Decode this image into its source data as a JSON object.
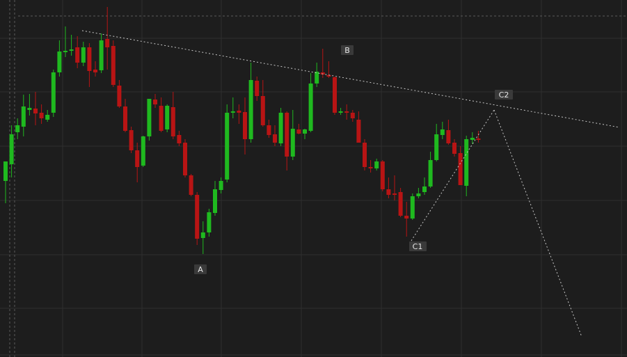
{
  "chart_data": {
    "type": "candlestick",
    "x_range": [
      0,
      115
    ],
    "y_range": [
      0,
      513
    ],
    "grid": true,
    "colors": {
      "up": "#1fb91f",
      "down": "#b81414",
      "background": "#1d1d1d",
      "grid": "#2f2f2f",
      "trend": "#c8c8c8"
    },
    "candles": [
      {
        "x": 0,
        "o": 260,
        "h": 235,
        "l": 292,
        "c": 232
      },
      {
        "x": 1,
        "o": 236,
        "h": 180,
        "l": 255,
        "c": 193
      },
      {
        "x": 2,
        "o": 190,
        "h": 170,
        "l": 200,
        "c": 180
      },
      {
        "x": 3,
        "o": 182,
        "h": 136,
        "l": 196,
        "c": 153
      },
      {
        "x": 4,
        "o": 158,
        "h": 135,
        "l": 166,
        "c": 155
      },
      {
        "x": 5,
        "o": 156,
        "h": 132,
        "l": 180,
        "c": 163
      },
      {
        "x": 6,
        "o": 162,
        "h": 150,
        "l": 178,
        "c": 170
      },
      {
        "x": 7,
        "o": 172,
        "h": 158,
        "l": 175,
        "c": 165
      },
      {
        "x": 8,
        "o": 162,
        "h": 100,
        "l": 168,
        "c": 104
      },
      {
        "x": 9,
        "o": 104,
        "h": 58,
        "l": 110,
        "c": 74
      },
      {
        "x": 10,
        "o": 74,
        "h": 38,
        "l": 82,
        "c": 73
      },
      {
        "x": 11,
        "o": 72,
        "h": 50,
        "l": 80,
        "c": 71
      },
      {
        "x": 12,
        "o": 68,
        "h": 52,
        "l": 98,
        "c": 90
      },
      {
        "x": 13,
        "o": 90,
        "h": 60,
        "l": 95,
        "c": 68
      },
      {
        "x": 14,
        "o": 68,
        "h": 62,
        "l": 125,
        "c": 102
      },
      {
        "x": 15,
        "o": 100,
        "h": 88,
        "l": 110,
        "c": 104
      },
      {
        "x": 16,
        "o": 101,
        "h": 48,
        "l": 105,
        "c": 58
      },
      {
        "x": 17,
        "o": 56,
        "h": 10,
        "l": 100,
        "c": 68
      },
      {
        "x": 18,
        "o": 66,
        "h": 58,
        "l": 125,
        "c": 122
      },
      {
        "x": 19,
        "o": 123,
        "h": 115,
        "l": 155,
        "c": 153
      },
      {
        "x": 20,
        "o": 153,
        "h": 142,
        "l": 190,
        "c": 188
      },
      {
        "x": 21,
        "o": 187,
        "h": 182,
        "l": 220,
        "c": 216
      },
      {
        "x": 22,
        "o": 216,
        "h": 205,
        "l": 262,
        "c": 240
      },
      {
        "x": 23,
        "o": 238,
        "h": 195,
        "l": 240,
        "c": 196
      },
      {
        "x": 24,
        "o": 196,
        "h": 142,
        "l": 202,
        "c": 142
      },
      {
        "x": 25,
        "o": 143,
        "h": 135,
        "l": 155,
        "c": 150
      },
      {
        "x": 26,
        "o": 152,
        "h": 140,
        "l": 190,
        "c": 188
      },
      {
        "x": 27,
        "o": 186,
        "h": 150,
        "l": 190,
        "c": 152
      },
      {
        "x": 28,
        "o": 154,
        "h": 132,
        "l": 200,
        "c": 196
      },
      {
        "x": 29,
        "o": 194,
        "h": 188,
        "l": 210,
        "c": 206
      },
      {
        "x": 30,
        "o": 205,
        "h": 200,
        "l": 255,
        "c": 252
      },
      {
        "x": 31,
        "o": 252,
        "h": 250,
        "l": 282,
        "c": 280
      },
      {
        "x": 32,
        "o": 280,
        "h": 276,
        "l": 352,
        "c": 343
      },
      {
        "x": 33,
        "o": 342,
        "h": 318,
        "l": 365,
        "c": 334
      },
      {
        "x": 34,
        "o": 334,
        "h": 300,
        "l": 340,
        "c": 305
      },
      {
        "x": 35,
        "o": 306,
        "h": 260,
        "l": 310,
        "c": 272
      },
      {
        "x": 36,
        "o": 273,
        "h": 255,
        "l": 278,
        "c": 260
      },
      {
        "x": 37,
        "o": 258,
        "h": 150,
        "l": 262,
        "c": 162
      },
      {
        "x": 38,
        "o": 162,
        "h": 140,
        "l": 170,
        "c": 160
      },
      {
        "x": 39,
        "o": 159,
        "h": 150,
        "l": 178,
        "c": 162
      },
      {
        "x": 40,
        "o": 161,
        "h": 140,
        "l": 222,
        "c": 200
      },
      {
        "x": 41,
        "o": 200,
        "h": 90,
        "l": 205,
        "c": 115
      },
      {
        "x": 42,
        "o": 116,
        "h": 110,
        "l": 145,
        "c": 138
      },
      {
        "x": 43,
        "o": 138,
        "h": 115,
        "l": 182,
        "c": 180
      },
      {
        "x": 44,
        "o": 180,
        "h": 172,
        "l": 198,
        "c": 194
      },
      {
        "x": 45,
        "o": 193,
        "h": 180,
        "l": 210,
        "c": 205
      },
      {
        "x": 46,
        "o": 206,
        "h": 155,
        "l": 210,
        "c": 162
      },
      {
        "x": 47,
        "o": 162,
        "h": 160,
        "l": 245,
        "c": 225
      },
      {
        "x": 48,
        "o": 225,
        "h": 158,
        "l": 230,
        "c": 185
      },
      {
        "x": 49,
        "o": 186,
        "h": 178,
        "l": 193,
        "c": 192
      },
      {
        "x": 50,
        "o": 192,
        "h": 185,
        "l": 200,
        "c": 186
      },
      {
        "x": 51,
        "o": 188,
        "h": 105,
        "l": 190,
        "c": 120
      },
      {
        "x": 52,
        "o": 120,
        "h": 90,
        "l": 125,
        "c": 103
      },
      {
        "x": 53,
        "o": 104,
        "h": 70,
        "l": 112,
        "c": 107
      },
      {
        "x": 54,
        "o": 108,
        "h": 88,
        "l": 112,
        "c": 110
      },
      {
        "x": 55,
        "o": 111,
        "h": 110,
        "l": 165,
        "c": 162
      },
      {
        "x": 56,
        "o": 161,
        "h": 155,
        "l": 165,
        "c": 160
      },
      {
        "x": 57,
        "o": 160,
        "h": 150,
        "l": 172,
        "c": 162
      },
      {
        "x": 58,
        "o": 162,
        "h": 158,
        "l": 175,
        "c": 170
      },
      {
        "x": 59,
        "o": 172,
        "h": 160,
        "l": 205,
        "c": 205
      },
      {
        "x": 60,
        "o": 205,
        "h": 200,
        "l": 245,
        "c": 240
      },
      {
        "x": 61,
        "o": 240,
        "h": 230,
        "l": 248,
        "c": 242
      },
      {
        "x": 62,
        "o": 242,
        "h": 228,
        "l": 245,
        "c": 232
      },
      {
        "x": 63,
        "o": 232,
        "h": 230,
        "l": 275,
        "c": 272
      },
      {
        "x": 64,
        "o": 272,
        "h": 255,
        "l": 285,
        "c": 280
      },
      {
        "x": 65,
        "o": 278,
        "h": 252,
        "l": 288,
        "c": 278
      },
      {
        "x": 66,
        "o": 276,
        "h": 270,
        "l": 312,
        "c": 310
      },
      {
        "x": 67,
        "o": 310,
        "h": 290,
        "l": 340,
        "c": 314
      },
      {
        "x": 68,
        "o": 314,
        "h": 278,
        "l": 316,
        "c": 282
      },
      {
        "x": 69,
        "o": 282,
        "h": 270,
        "l": 285,
        "c": 278
      },
      {
        "x": 70,
        "o": 276,
        "h": 255,
        "l": 280,
        "c": 268
      },
      {
        "x": 71,
        "o": 268,
        "h": 218,
        "l": 270,
        "c": 230
      },
      {
        "x": 72,
        "o": 230,
        "h": 178,
        "l": 232,
        "c": 193
      },
      {
        "x": 73,
        "o": 194,
        "h": 175,
        "l": 200,
        "c": 186
      },
      {
        "x": 74,
        "o": 187,
        "h": 172,
        "l": 208,
        "c": 206
      },
      {
        "x": 75,
        "o": 205,
        "h": 200,
        "l": 225,
        "c": 221
      },
      {
        "x": 76,
        "o": 220,
        "h": 210,
        "l": 265,
        "c": 266
      },
      {
        "x": 77,
        "o": 267,
        "h": 195,
        "l": 282,
        "c": 200
      },
      {
        "x": 78,
        "o": 201,
        "h": 190,
        "l": 207,
        "c": 198
      },
      {
        "x": 79,
        "o": 199,
        "h": 188,
        "l": 205,
        "c": 199
      }
    ],
    "labels": [
      {
        "text": "A"
      },
      {
        "text": "B"
      },
      {
        "text": "C1"
      },
      {
        "text": "C2"
      }
    ]
  }
}
